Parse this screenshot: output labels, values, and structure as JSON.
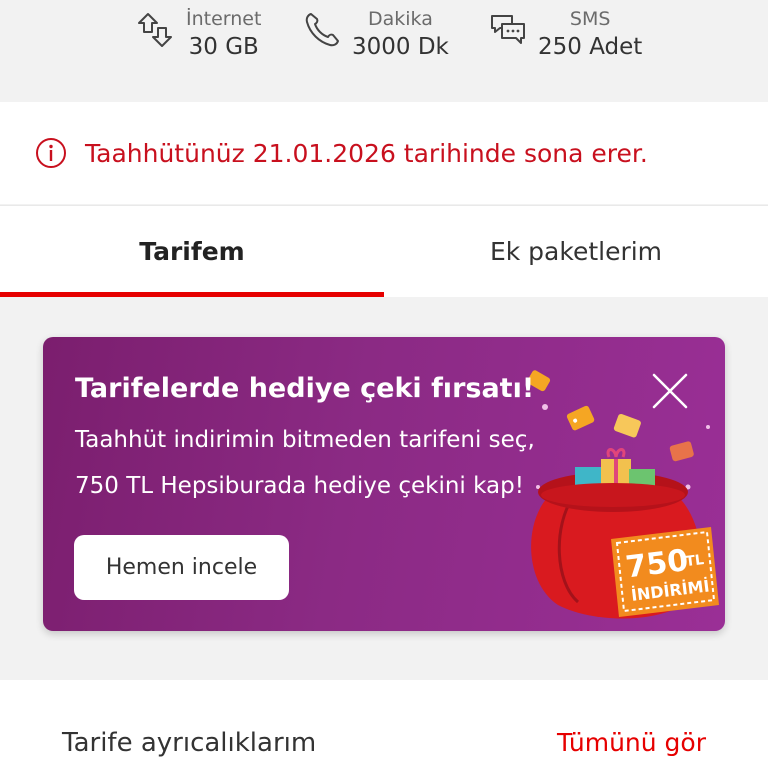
{
  "usage": [
    {
      "icon": "data-transfer-icon",
      "label": "İnternet",
      "value": "30 GB"
    },
    {
      "icon": "phone-icon",
      "label": "Dakika",
      "value": "3000 Dk"
    },
    {
      "icon": "message-icon",
      "label": "SMS",
      "value": "250 Adet"
    }
  ],
  "notice": {
    "icon": "info-icon",
    "text": "Taahhütünüz 21.01.2026 tarihinde sona erer."
  },
  "tabs": [
    {
      "label": "Tarifem",
      "active": true
    },
    {
      "label": "Ek paketlerim",
      "active": false
    }
  ],
  "banner": {
    "title": "Tarifelerde hediye çeki fırsatı!",
    "line1": "Taahhüt indirimin bitmeden tarifeni seç,",
    "line2": "750 TL Hepsiburada hediye çekini kap!",
    "button": "Hemen incele",
    "badge_amount": "750",
    "badge_unit": "TL",
    "badge_text": "İNDİRİMİ"
  },
  "section": {
    "title": "Tarife ayrıcalıklarım",
    "link": "Tümünü gör"
  },
  "colors": {
    "accent": "#e60000",
    "banner": "#8b2a84"
  }
}
